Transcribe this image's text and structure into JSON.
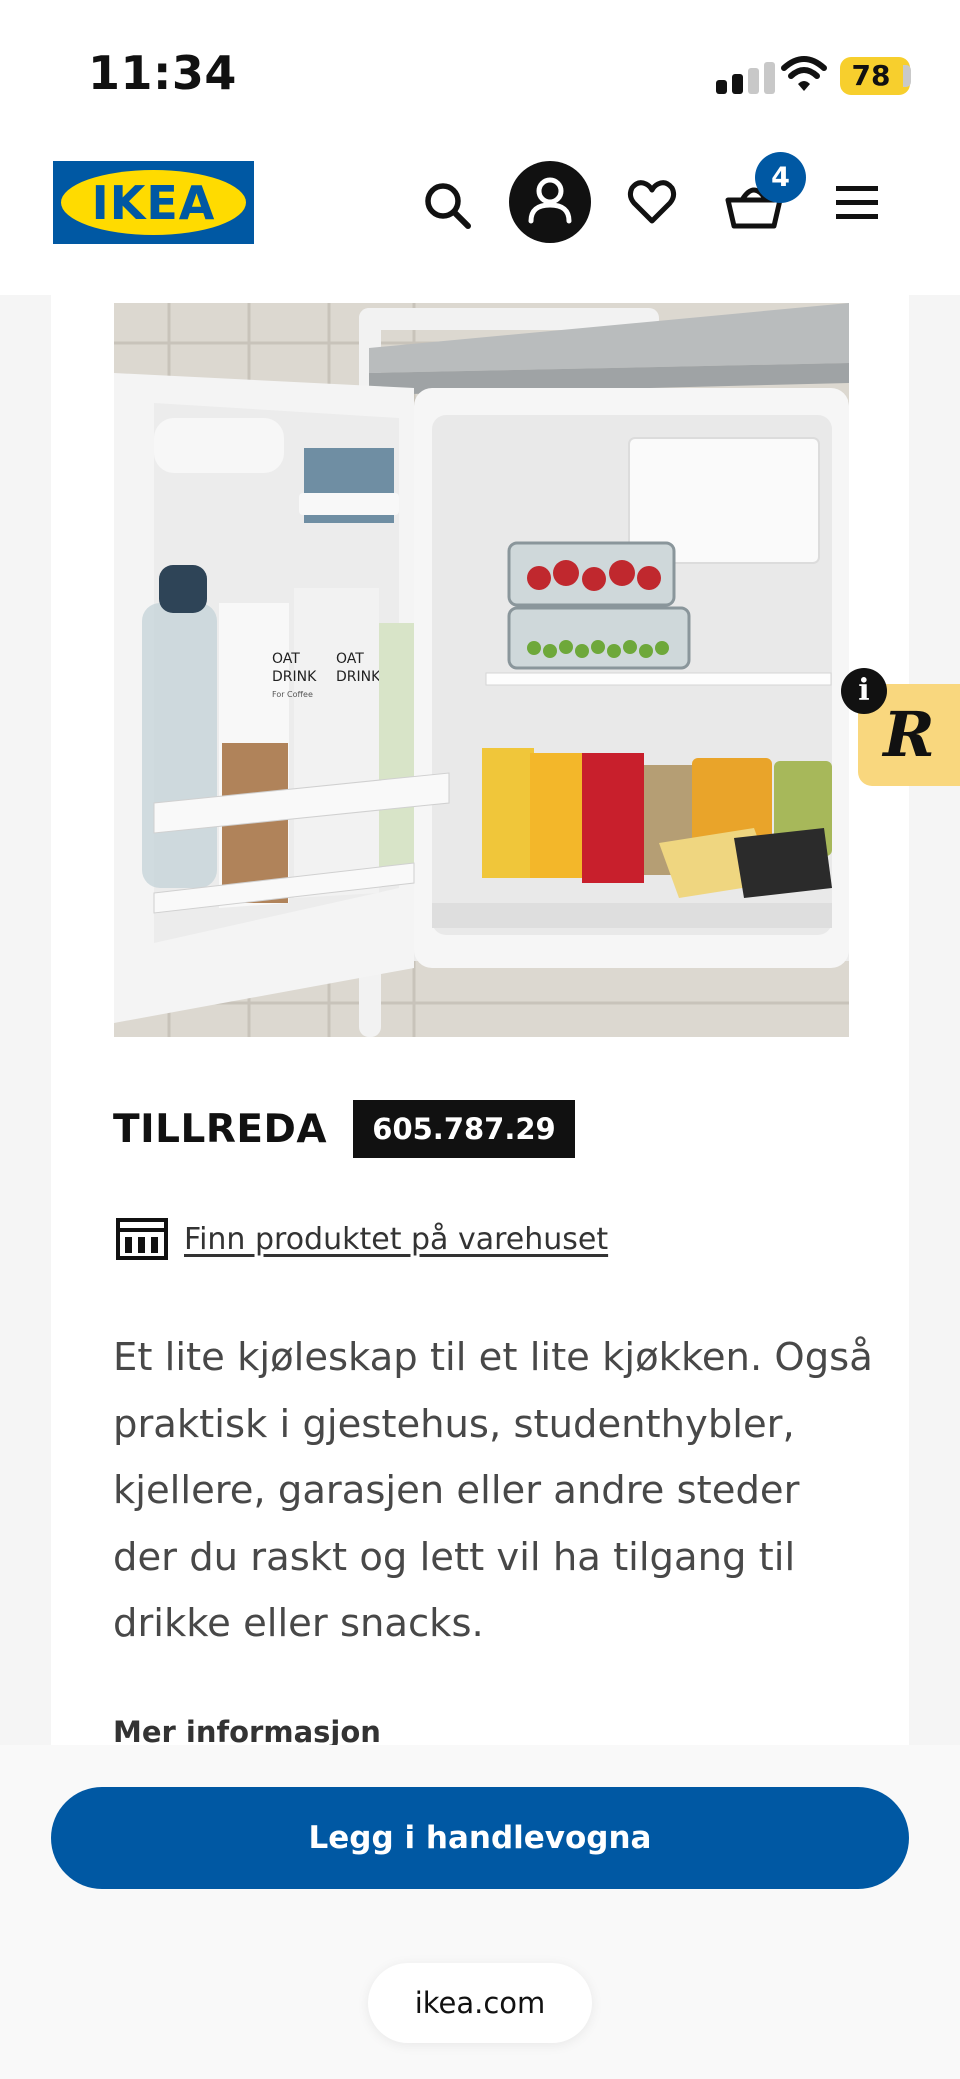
{
  "status_bar": {
    "time": "11:34",
    "battery": "78",
    "icons": [
      "signal-icon",
      "wifi-icon",
      "battery-icon"
    ]
  },
  "header": {
    "logo": "IKEA",
    "cart_count": "4",
    "icons": [
      "search-icon",
      "account-icon",
      "heart-icon",
      "basket-icon",
      "hamburger-menu-icon"
    ],
    "colors": {
      "brand_blue": "#0058a3",
      "brand_yellow": "#ffdb00"
    }
  },
  "product": {
    "name": "TILLREDA",
    "article_number": "605.787.29",
    "store_link": "Finn produktet på varehuset",
    "description": "Et lite kjøleskap til et lite kjøkken. Også praktisk i gjestehus, studenthybler, kjellere, garasjen eller andre steder der du raskt og lett vil ha tilgang til drikke eller snacks.",
    "more_info": "Mer informasjon",
    "image": {
      "carton_1_line1": "OAT",
      "carton_1_line2": "DRINK",
      "carton_1_sub": "For Coffee",
      "carton_2_line1": "OAT",
      "carton_2_line2": "DRINK"
    }
  },
  "bottom_bar": {
    "add_to_cart": "Legg i handlevogna",
    "url": "ikea.com"
  },
  "widget": {
    "letter": "R",
    "info": "i",
    "color": "#f9d77e"
  }
}
